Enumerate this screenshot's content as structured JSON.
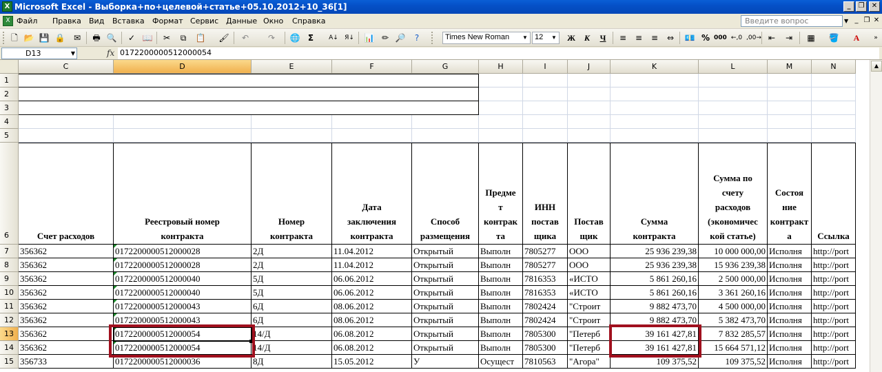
{
  "window": {
    "title": "Microsoft Excel - Выборка+по+целевой+статье+05.10.2012+10_36[1]",
    "app_icon": "X",
    "btn_min": "_",
    "btn_restore": "❐",
    "btn_close": "✕"
  },
  "menu": {
    "items": [
      "Файл",
      "Правка",
      "Вид",
      "Вставка",
      "Формат",
      "Сервис",
      "Данные",
      "Окно",
      "Справка"
    ],
    "help_placeholder": "Введите вопрос"
  },
  "toolbar": {
    "font_name": "Times New Roman",
    "font_size": "12",
    "bold": "Ж",
    "italic": "К",
    "underline": "Ч",
    "percent": "%",
    "thousands": "000",
    "sigma": "Σ"
  },
  "formula_bar": {
    "name_box": "D13",
    "fx": "fx",
    "value": "0172200000512000054"
  },
  "grid": {
    "columns": [
      "C",
      "D",
      "E",
      "F",
      "G",
      "H",
      "I",
      "J",
      "K",
      "L",
      "M",
      "N"
    ],
    "row_numbers": [
      "1",
      "2",
      "3",
      "4",
      "5",
      "6",
      "7",
      "8",
      "9",
      "10",
      "11",
      "12",
      "13",
      "14",
      "15"
    ],
    "headers": [
      [
        "Счет расходов"
      ],
      [
        "Реестровый номер",
        "контракта"
      ],
      [
        "Номер",
        "контракта"
      ],
      [
        "Дата",
        "заключения",
        "контракта"
      ],
      [
        "Способ",
        "размещения"
      ],
      [
        "Предме",
        "т",
        "контрак",
        "та"
      ],
      [
        "ИНН",
        "постав",
        "щика"
      ],
      [
        "Постав",
        "щик"
      ],
      [
        "Сумма",
        "контракта"
      ],
      [
        "Сумма по",
        "счету",
        "расходов",
        "(экономичес",
        "кой статье)"
      ],
      [
        "Состоя",
        "ние",
        "контракт",
        "а"
      ],
      [
        "Ссылка"
      ]
    ],
    "rows": [
      [
        "356362",
        "0172200000512000028",
        "2Д",
        "11.04.2012",
        "Открытый",
        "Выполн",
        "7805277",
        "ООО",
        "25 936 239,38",
        "10 000 000,00",
        "Исполня",
        "http://port"
      ],
      [
        "356362",
        "0172200000512000028",
        "2Д",
        "11.04.2012",
        "Открытый",
        "Выполн",
        "7805277",
        "ООО",
        "25 936 239,38",
        "15 936 239,38",
        "Исполня",
        "http://port"
      ],
      [
        "356362",
        "0172200000512000040",
        "5Д",
        "06.06.2012",
        "Открытый",
        "Выполн",
        "7816353",
        "«ИСТО",
        "5 861 260,16",
        "2 500 000,00",
        "Исполня",
        "http://port"
      ],
      [
        "356362",
        "0172200000512000040",
        "5Д",
        "06.06.2012",
        "Открытый",
        "Выполн",
        "7816353",
        "«ИСТО",
        "5 861 260,16",
        "3 361 260,16",
        "Исполня",
        "http://port"
      ],
      [
        "356362",
        "0172200000512000043",
        "6Д",
        "08.06.2012",
        "Открытый",
        "Выполн",
        "7802424",
        "\"Строит",
        "9 882 473,70",
        "4 500 000,00",
        "Исполня",
        "http://port"
      ],
      [
        "356362",
        "0172200000512000043",
        "6Д",
        "08.06.2012",
        "Открытый",
        "Выполн",
        "7802424",
        "\"Строит",
        "9 882 473,70",
        "5 382 473,70",
        "Исполня",
        "http://port"
      ],
      [
        "356362",
        "0172200000512000054",
        "14/Д",
        "06.08.2012",
        "Открытый",
        "Выполн",
        "7805300",
        "\"Петерб",
        "39 161 427,81",
        "7 832 285,57",
        "Исполня",
        "http://port"
      ],
      [
        "356362",
        "0172200000512000054",
        "14/Д",
        "06.08.2012",
        "Открытый",
        "Выполн",
        "7805300",
        "\"Петерб",
        "39 161 427,81",
        "15 664 571,12",
        "Исполня",
        "http://port"
      ],
      [
        "356733",
        "0172200000512000036",
        "8Д",
        "15.05.2012",
        "У",
        "Осущест",
        "7810563",
        "\"Агора\"",
        "109 375,52",
        "109 375,52",
        "Исполня",
        "http://port"
      ]
    ]
  },
  "colors": {
    "highlight": "#a0101e",
    "selection_header": "#f0b04d"
  }
}
